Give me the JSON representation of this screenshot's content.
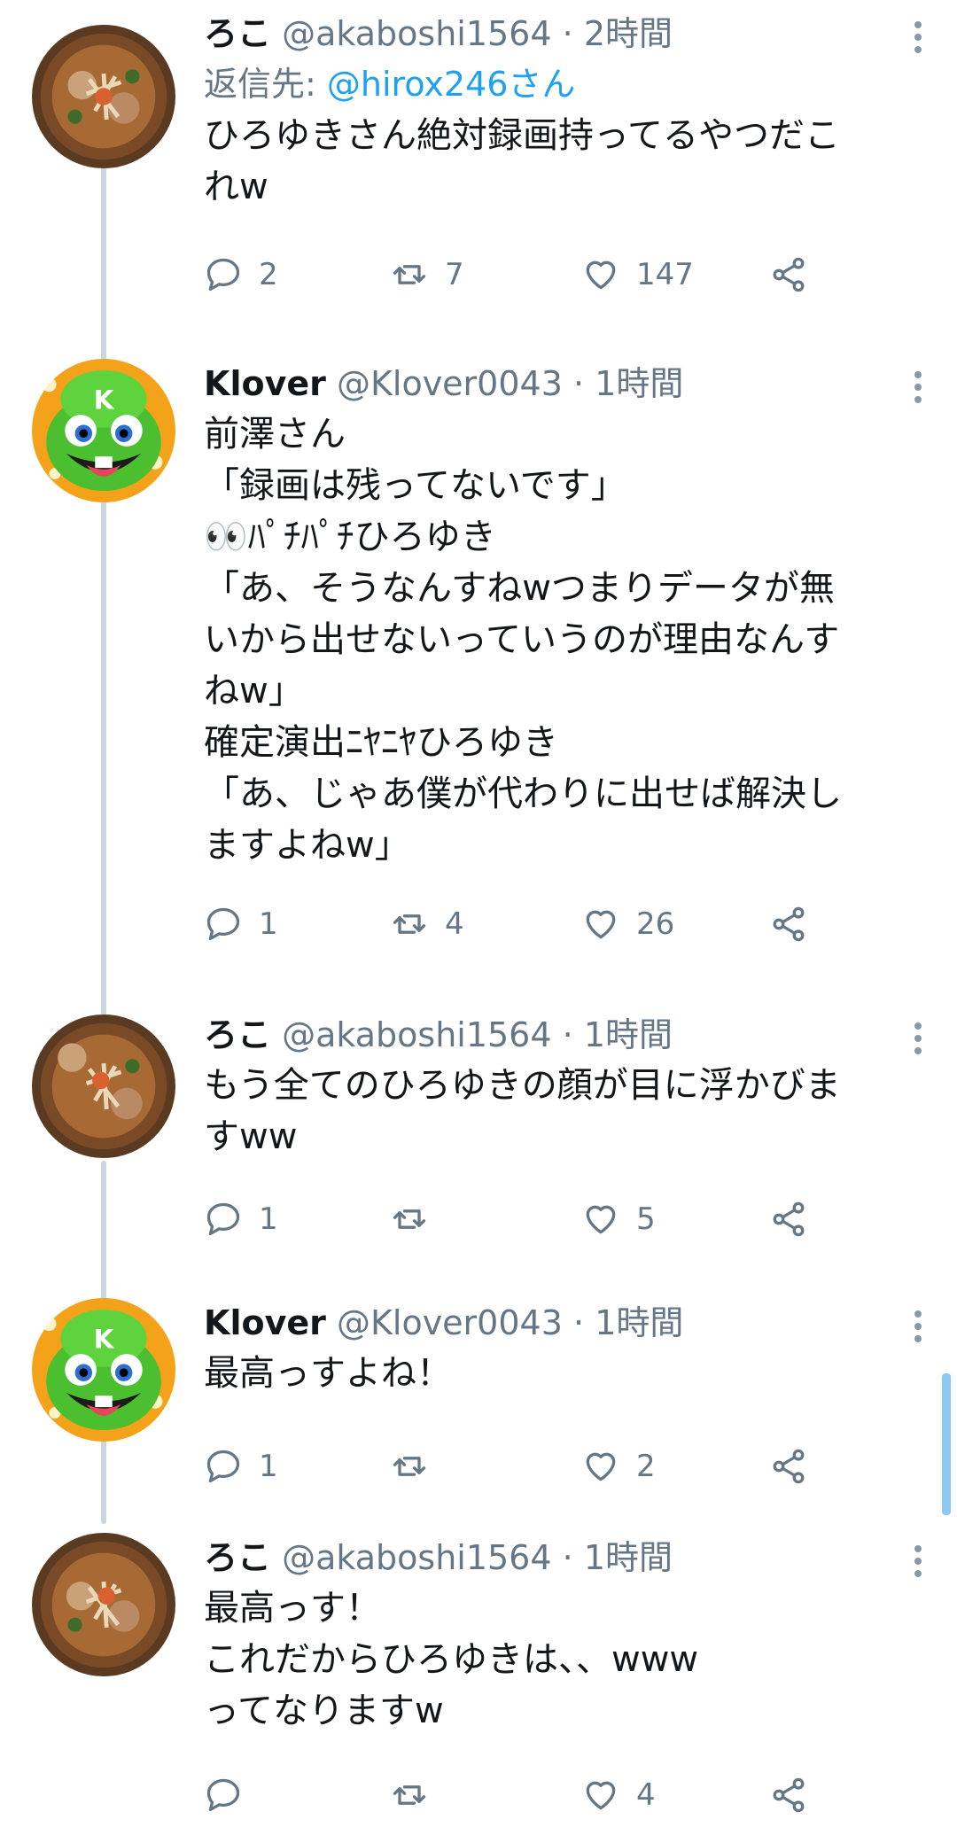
{
  "colors": {
    "accent": "#1da1f2",
    "muted": "#657786",
    "text": "#14171a",
    "line": "#ccd6dd"
  },
  "tweets": [
    {
      "name": "ろこ",
      "handle": "@akaboshi1564",
      "dot": "·",
      "time": "2時間",
      "reply_prefix": "返信先: ",
      "reply_to": "@hirox246さん",
      "text": "ひろゆきさん絶対録画持ってるやつだこ\nれw",
      "replies": "2",
      "retweets": "7",
      "likes": "147",
      "avatar": "ramen-avatar"
    },
    {
      "name": "Klover",
      "handle": "@Klover0043",
      "dot": "·",
      "time": "1時間",
      "text": "前澤さん\n「録画は残ってないです」\n👀ﾊﾟﾁﾊﾟﾁひろゆき\n「あ、そうなんすねwつまりデータが無\nいから出せないっていうのが理由なんす\nねw」\n確定演出ﾆﾔﾆﾔひろゆき\n「あ、じゃあ僕が代わりに出せば解決し\nますよねw」",
      "replies": "1",
      "retweets": "4",
      "likes": "26",
      "avatar": "frog-avatar"
    },
    {
      "name": "ろこ",
      "handle": "@akaboshi1564",
      "dot": "·",
      "time": "1時間",
      "text": "もう全てのひろゆきの顔が目に浮かびま\nすww",
      "replies": "1",
      "retweets": "",
      "likes": "5",
      "avatar": "ramen-avatar"
    },
    {
      "name": "Klover",
      "handle": "@Klover0043",
      "dot": "·",
      "time": "1時間",
      "text": "最高っすよね！",
      "replies": "1",
      "retweets": "",
      "likes": "2",
      "avatar": "frog-avatar"
    },
    {
      "name": "ろこ",
      "handle": "@akaboshi1564",
      "dot": "·",
      "time": "1時間",
      "text": "最高っす！\nこれだからひろゆきは、、www\nってなりますw",
      "replies": "",
      "retweets": "",
      "likes": "4",
      "avatar": "ramen-avatar"
    }
  ]
}
